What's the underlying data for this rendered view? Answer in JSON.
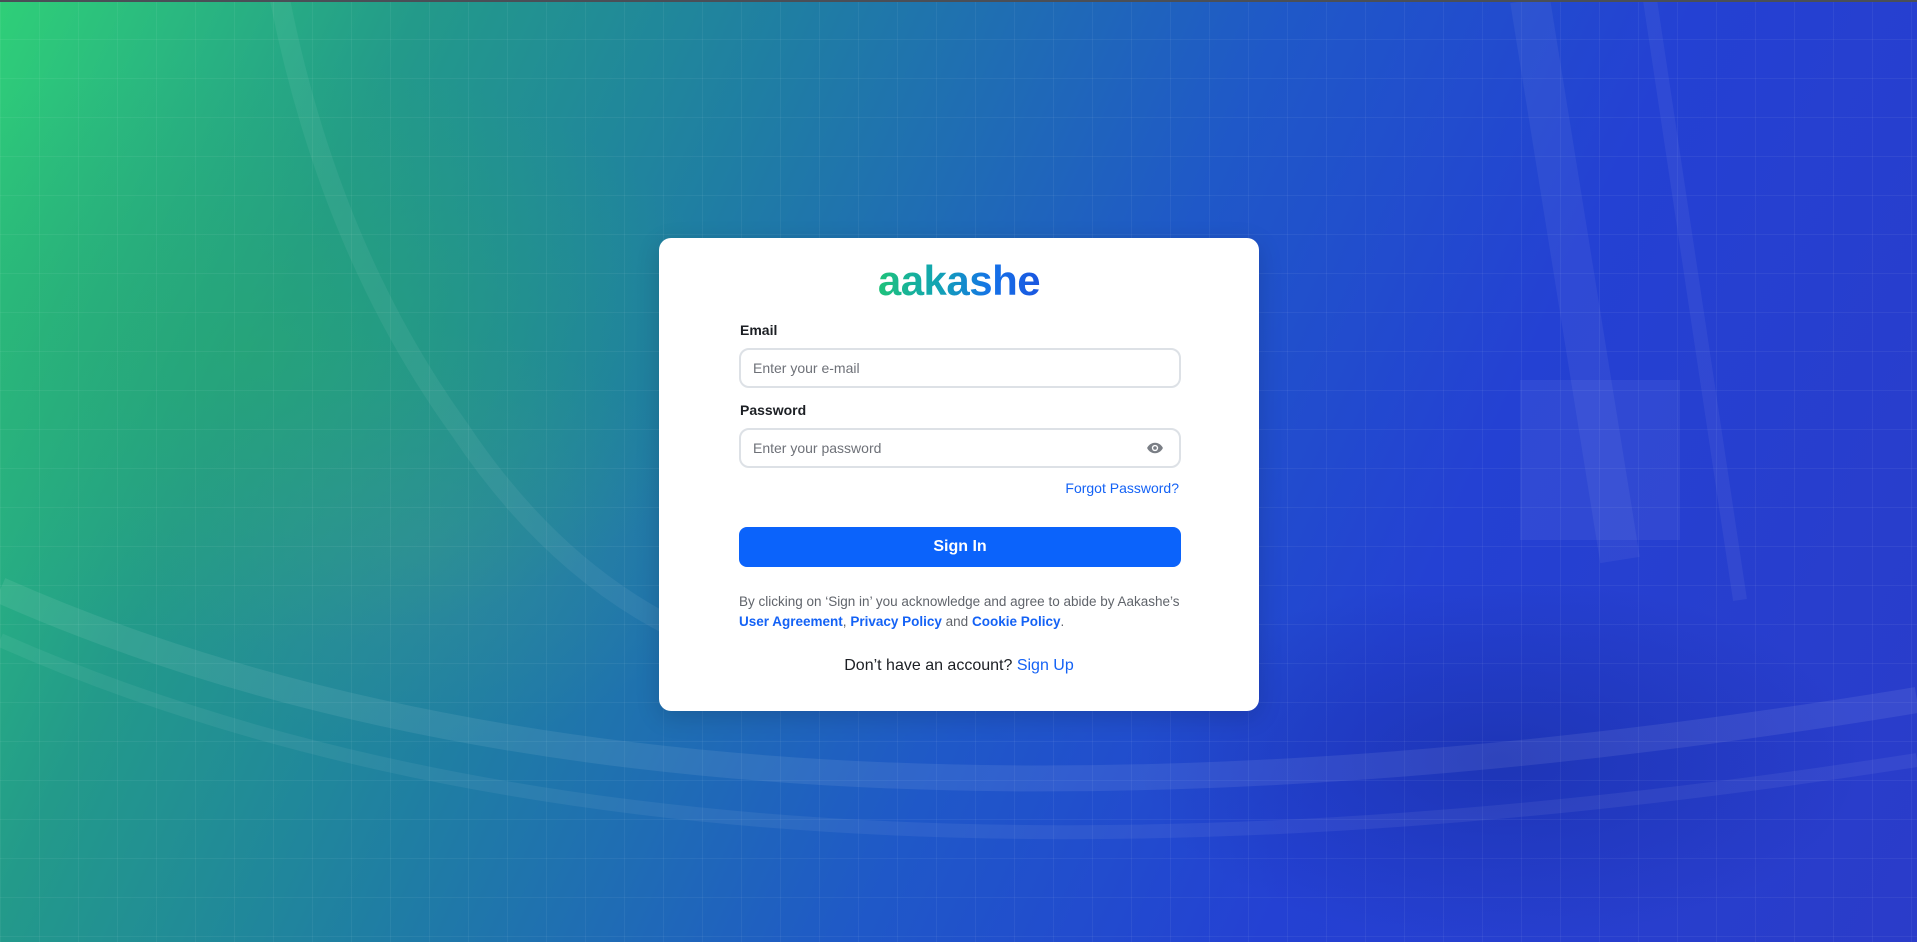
{
  "brand": {
    "name": "aakashe",
    "gradient_colors": [
      "#1fc27a",
      "#12a6b0",
      "#1572e8",
      "#1a56e0"
    ]
  },
  "form": {
    "email": {
      "label": "Email",
      "placeholder": "Enter your e-mail",
      "value": ""
    },
    "password": {
      "label": "Password",
      "placeholder": "Enter your password",
      "value": "",
      "toggle_icon": "eye-icon"
    },
    "forgot_link": "Forgot Password?",
    "submit_label": "Sign In"
  },
  "legal": {
    "prefix": "By clicking on ‘Sign in’ you acknowledge and agree to abide by Aakashe’s",
    "user_agreement": "User Agreement",
    "sep1": ",",
    "privacy_policy": "Privacy Policy",
    "and": "and",
    "cookie_policy": "Cookie Policy",
    "suffix": "."
  },
  "signup": {
    "prompt": "Don’t have an account?",
    "link": "Sign Up"
  },
  "colors": {
    "accent": "#0b63fb",
    "link": "#1462f5",
    "bg_start": "#2fcf78",
    "bg_end": "#2a3cc9"
  }
}
